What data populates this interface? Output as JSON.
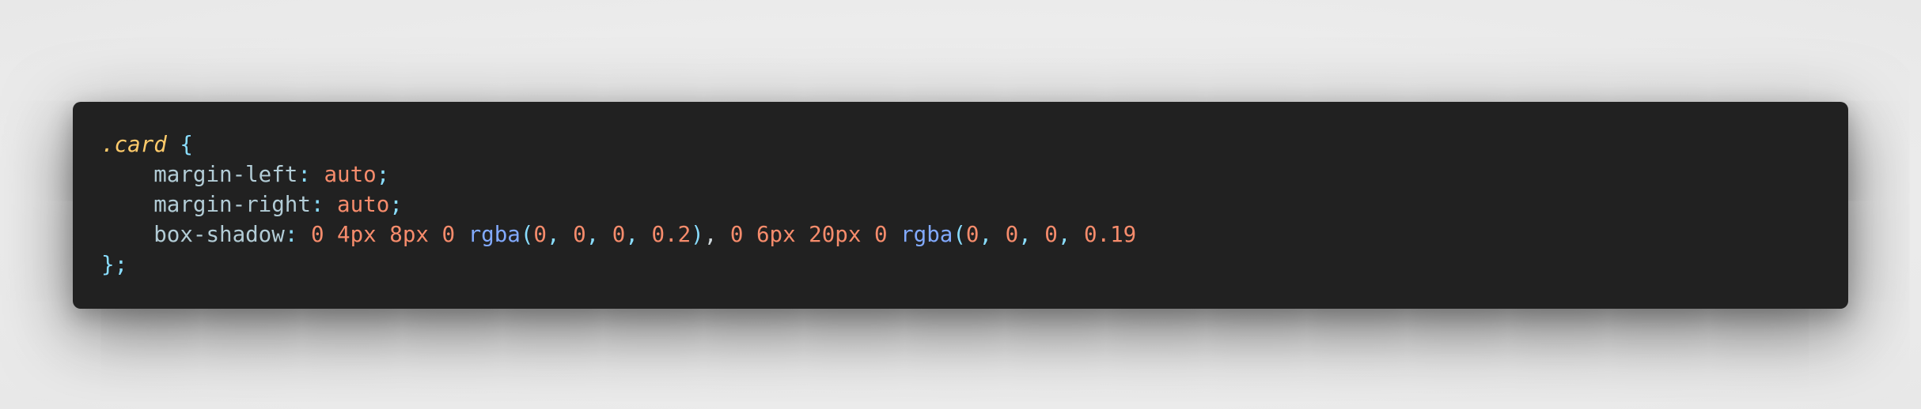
{
  "code": {
    "lines": [
      [
        {
          "cls": "selector",
          "text": ".card"
        },
        {
          "cls": "plain",
          "text": " "
        },
        {
          "cls": "brace",
          "text": "{"
        }
      ],
      [
        {
          "cls": "plain",
          "text": "    "
        },
        {
          "cls": "prop",
          "text": "margin-left"
        },
        {
          "cls": "punct",
          "text": ": "
        },
        {
          "cls": "value",
          "text": "auto"
        },
        {
          "cls": "punct",
          "text": ";"
        }
      ],
      [
        {
          "cls": "plain",
          "text": "    "
        },
        {
          "cls": "prop",
          "text": "margin-right"
        },
        {
          "cls": "punct",
          "text": ": "
        },
        {
          "cls": "value",
          "text": "auto"
        },
        {
          "cls": "punct",
          "text": ";"
        }
      ],
      [
        {
          "cls": "plain",
          "text": "    "
        },
        {
          "cls": "prop",
          "text": "box-shadow"
        },
        {
          "cls": "punct",
          "text": ": "
        },
        {
          "cls": "value",
          "text": "0 4px 8px 0"
        },
        {
          "cls": "plain",
          "text": " "
        },
        {
          "cls": "func",
          "text": "rgba"
        },
        {
          "cls": "punct",
          "text": "("
        },
        {
          "cls": "value",
          "text": "0"
        },
        {
          "cls": "punct",
          "text": ", "
        },
        {
          "cls": "value",
          "text": "0"
        },
        {
          "cls": "punct",
          "text": ", "
        },
        {
          "cls": "value",
          "text": "0"
        },
        {
          "cls": "punct",
          "text": ", "
        },
        {
          "cls": "value",
          "text": "0.2"
        },
        {
          "cls": "punct",
          "text": ")"
        },
        {
          "cls": "plain",
          "text": ", "
        },
        {
          "cls": "value",
          "text": "0 6px 20px 0"
        },
        {
          "cls": "plain",
          "text": " "
        },
        {
          "cls": "func",
          "text": "rgba"
        },
        {
          "cls": "punct",
          "text": "("
        },
        {
          "cls": "value",
          "text": "0"
        },
        {
          "cls": "punct",
          "text": ", "
        },
        {
          "cls": "value",
          "text": "0"
        },
        {
          "cls": "punct",
          "text": ", "
        },
        {
          "cls": "value",
          "text": "0"
        },
        {
          "cls": "punct",
          "text": ", "
        },
        {
          "cls": "value",
          "text": "0.19"
        }
      ],
      [
        {
          "cls": "brace",
          "text": "}"
        },
        {
          "cls": "punct",
          "text": ";"
        }
      ]
    ]
  },
  "colors": {
    "background": "#ececec",
    "window": "#212121",
    "selector": "#ffcb6b",
    "brace": "#89ddff",
    "property": "#b2ccd6",
    "value": "#f78c6c",
    "function": "#82aaff"
  }
}
